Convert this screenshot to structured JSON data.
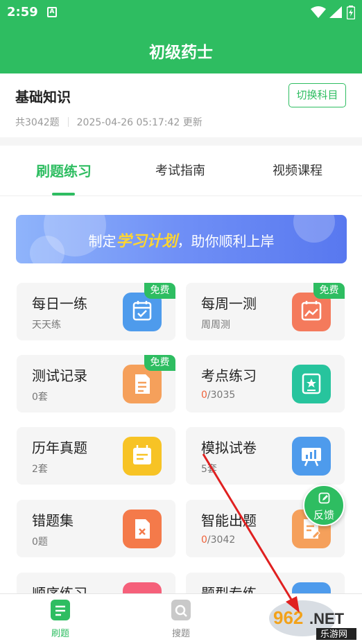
{
  "status_bar": {
    "time": "2:59",
    "app_notification_letter": "A"
  },
  "header": {
    "title": "初级药士"
  },
  "subject": {
    "name": "基础知识",
    "switch_label": "切换科目",
    "question_count": "共3042题",
    "updated_at": "2025-04-26 05:17:42 更新"
  },
  "tabs": [
    {
      "label": "刷题练习",
      "active": true
    },
    {
      "label": "考试指南",
      "active": false
    },
    {
      "label": "视频课程",
      "active": false
    }
  ],
  "banner": {
    "prefix": "制定",
    "highlight": "学习计划",
    "suffix": "，助你顺利上岸"
  },
  "cards": [
    {
      "title": "每日一练",
      "sub": "天天练",
      "badge": "免费",
      "icon": "calendar-check-icon",
      "color": "#4e9bec"
    },
    {
      "title": "每周一测",
      "sub": "周周测",
      "badge": "免费",
      "icon": "chart-calendar-icon",
      "color": "#f47a5c"
    },
    {
      "title": "测试记录",
      "sub": "0套",
      "badge": "免费",
      "icon": "document-icon",
      "color": "#f5a05b"
    },
    {
      "title": "考点练习",
      "sub_done": "0",
      "sub_total": "/3035",
      "icon": "star-board-icon",
      "color": "#27c49d"
    },
    {
      "title": "历年真题",
      "sub": "2套",
      "icon": "calendar-list-icon",
      "color": "#f7c325"
    },
    {
      "title": "模拟试卷",
      "sub": "5套",
      "icon": "presentation-chart-icon",
      "color": "#4e9bec"
    },
    {
      "title": "错题集",
      "sub": "0题",
      "icon": "wrong-file-icon",
      "color": "#f47a4a"
    },
    {
      "title": "智能出题",
      "sub_done": "0",
      "sub_total": "/3042",
      "icon": "edit-document-icon",
      "color": "#f5a05b"
    },
    {
      "title": "顺序练习",
      "icon": "list-icon",
      "color": "#f5607a"
    },
    {
      "title": "题型专练",
      "icon": "grid-icon",
      "color": "#4e9bec"
    }
  ],
  "feedback": {
    "label": "反馈"
  },
  "bottom_nav": [
    {
      "label": "刷题",
      "active": true
    },
    {
      "label": "搜题",
      "active": false
    }
  ],
  "watermark": {
    "logo_text": "962.NET",
    "site_text": "乐游网"
  },
  "colors": {
    "brand": "#2ebd61",
    "accent_red": "#f0623a",
    "annotation_arrow": "#e02020"
  }
}
